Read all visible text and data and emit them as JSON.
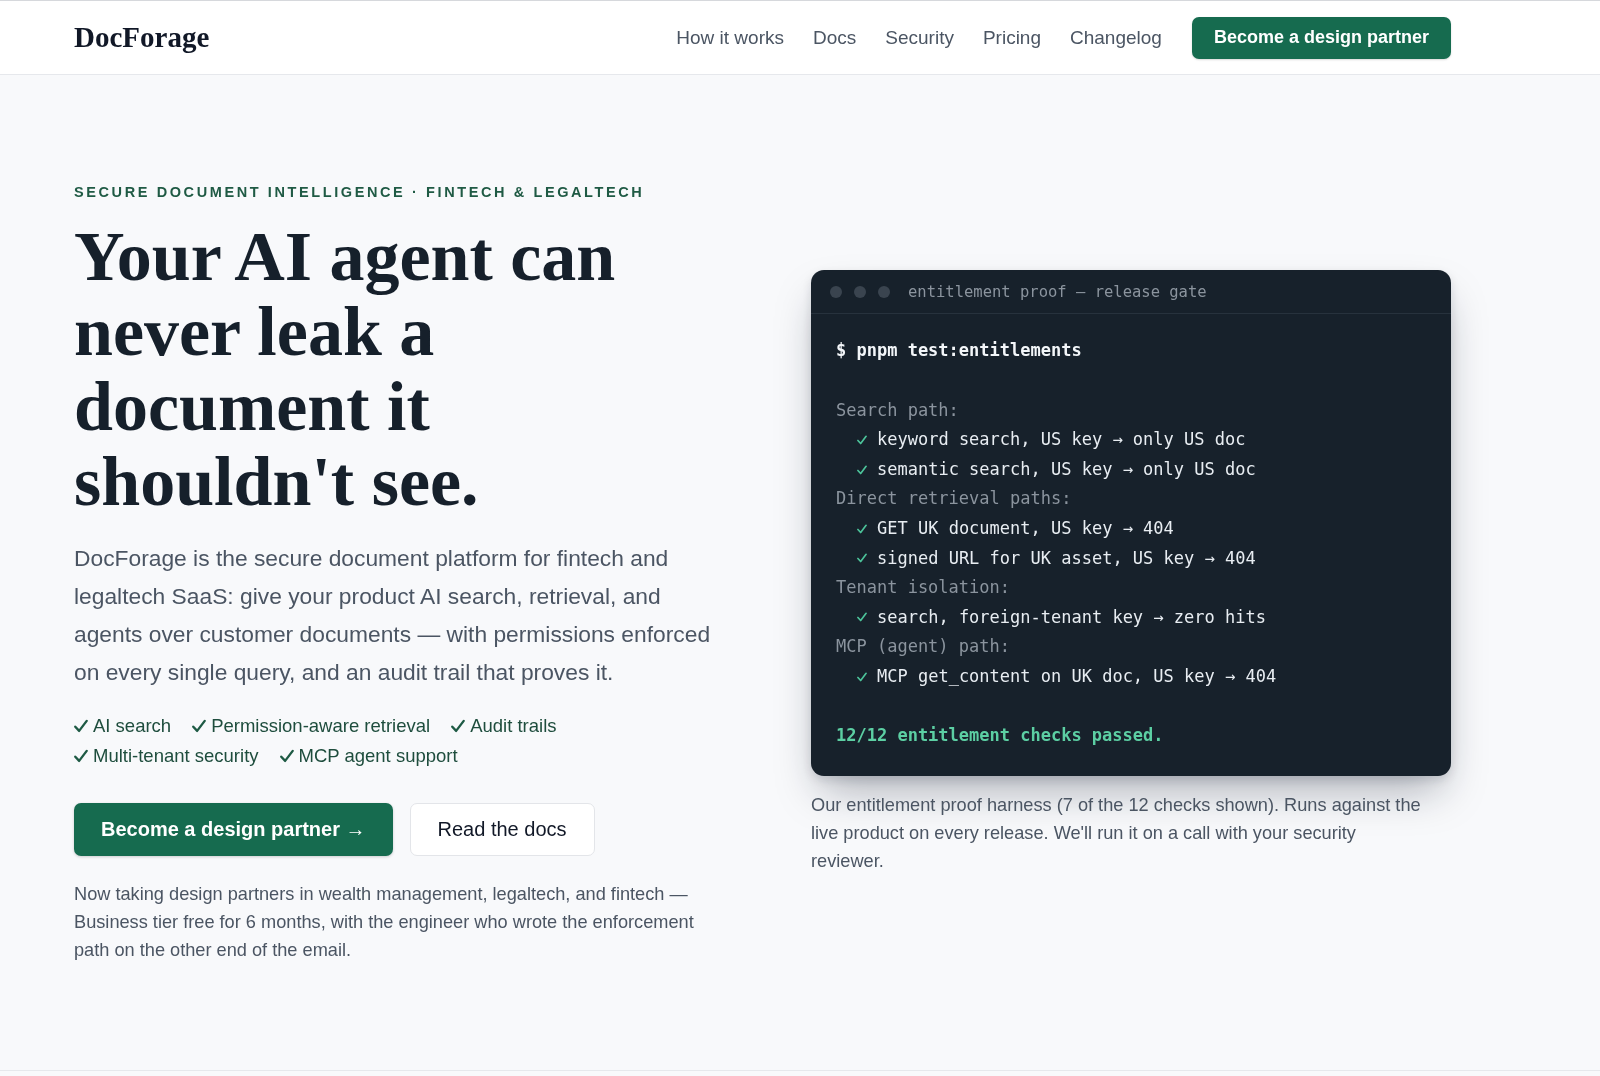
{
  "nav": {
    "logo": "DocForage",
    "links": [
      "How it works",
      "Docs",
      "Security",
      "Pricing",
      "Changelog"
    ],
    "cta": "Become a design partner"
  },
  "hero": {
    "eyebrow": "SECURE DOCUMENT INTELLIGENCE · FINTECH & LEGALTECH",
    "title": "Your AI agent can never leak a document it shouldn't see.",
    "lead": "DocForage is the secure document platform for fintech and legaltech SaaS: give your product AI search, retrieval, and agents over customer documents — with permissions enforced on every single query, and an audit trail that proves it.",
    "features": [
      "AI search",
      "Permission-aware retrieval",
      "Audit trails",
      "Multi-tenant security",
      "MCP agent support"
    ],
    "buttons": [
      {
        "label": "Become a design partner →",
        "kind": "primary"
      },
      {
        "label": "Read the docs",
        "kind": "secondary"
      }
    ],
    "note": "Now taking design partners in wealth management, legaltech, and fintech — Business tier free for 6 months, with the engineer who wrote the enforcement path on the other end of the email."
  },
  "terminal": {
    "title": "entitlement proof — release gate",
    "command": "$ pnpm test:entitlements",
    "groups": [
      {
        "heading": "Search path:",
        "checks": [
          "keyword search, US key → only US doc",
          "semantic search, US key → only US doc"
        ]
      },
      {
        "heading": "Direct retrieval paths:",
        "checks": [
          "GET UK document, US key → 404",
          "signed URL for UK asset, US key → 404"
        ]
      },
      {
        "heading": "Tenant isolation:",
        "checks": [
          "search, foreign-tenant key → zero hits"
        ]
      },
      {
        "heading": "MCP (agent) path:",
        "checks": [
          "MCP get_content on UK doc, US key → 404"
        ]
      }
    ],
    "summary": "12/12 entitlement checks passed.",
    "caption": "Our entitlement proof harness (7 of the 12 checks shown). Runs against the live product on every release. We'll run it on a call with your security reviewer."
  }
}
